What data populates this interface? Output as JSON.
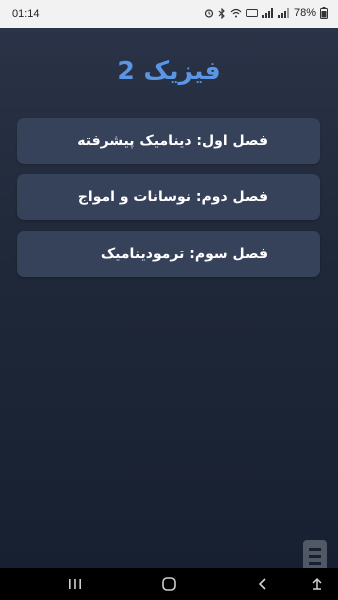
{
  "status_bar": {
    "time": "01:14",
    "battery": "78%",
    "icons": [
      "alarm-icon",
      "bluetooth-icon",
      "wifi-icon",
      "volte-icon",
      "signal-icon",
      "battery-icon"
    ]
  },
  "app": {
    "title": "فیزیک 2",
    "chapters": [
      {
        "label": "فصل اول: دینامیک پیشرفته"
      },
      {
        "label": "فصل دوم: نوسانات و امواج"
      },
      {
        "label": "فصل سوم: ترمودینامیک"
      }
    ]
  },
  "nav_bar": {
    "buttons": [
      "recent-apps",
      "home",
      "back",
      "keyboard-hide"
    ]
  },
  "colors": {
    "title": "#5b95e6",
    "card": "#36425a",
    "background_top": "#2a3347",
    "background_bottom": "#172031"
  }
}
